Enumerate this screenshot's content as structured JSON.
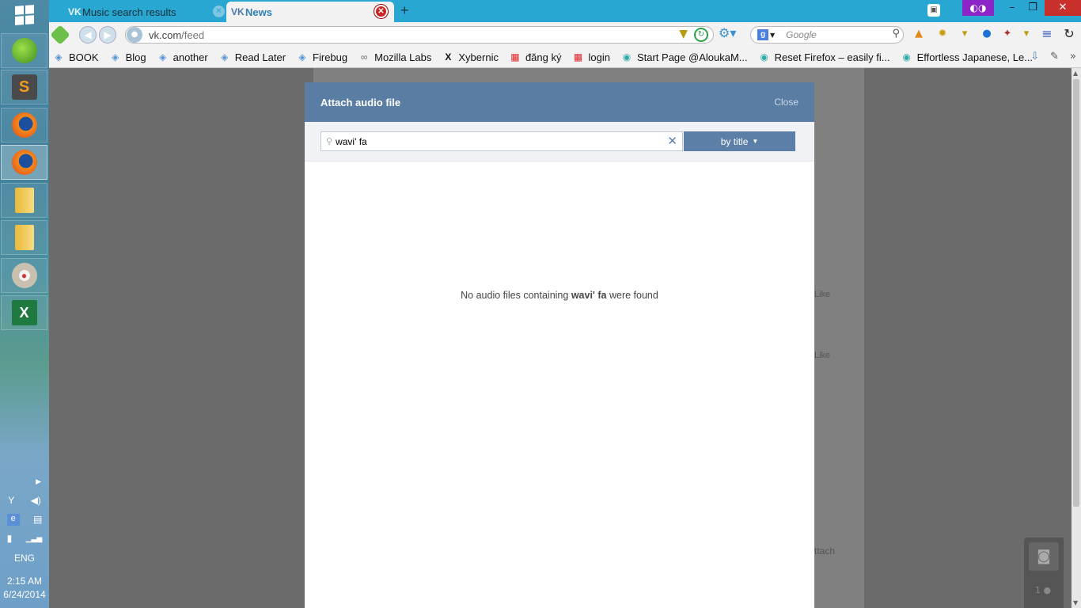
{
  "taskbar": {
    "apps": [
      {
        "name": "parrot-app"
      },
      {
        "name": "sublime-text",
        "letter": "S"
      },
      {
        "name": "firefox"
      },
      {
        "name": "firefox-active"
      },
      {
        "name": "file-explorer"
      },
      {
        "name": "file-explorer-2"
      },
      {
        "name": "paint"
      },
      {
        "name": "excel",
        "letter": "X"
      }
    ],
    "language": "ENG",
    "time": "2:15 AM",
    "date": "6/24/2014"
  },
  "browser": {
    "tabs": [
      {
        "label": "Music search results",
        "active": false
      },
      {
        "label": "News",
        "active": true
      }
    ],
    "url": {
      "host": "vk.com",
      "path": "/feed"
    },
    "search_placeholder": "Google",
    "bookmarks": [
      {
        "label": "BOOK",
        "icon": "shield"
      },
      {
        "label": "Blog",
        "icon": "shield"
      },
      {
        "label": "another",
        "icon": "shield"
      },
      {
        "label": "Read Later",
        "icon": "shield"
      },
      {
        "label": "Firebug",
        "icon": "shield"
      },
      {
        "label": "Mozilla Labs",
        "icon": "labs"
      },
      {
        "label": "Xybernic",
        "icon": "x"
      },
      {
        "label": "đăng ký",
        "icon": "red"
      },
      {
        "label": "login",
        "icon": "red"
      },
      {
        "label": "Start Page @AloukaM...",
        "icon": "globe"
      },
      {
        "label": "Reset Firefox – easily fi...",
        "icon": "globe"
      },
      {
        "label": "Effortless Japanese, Le...",
        "icon": "globe"
      }
    ]
  },
  "page": {
    "like_label": "Like",
    "attach_label": "ttach",
    "photo_count": "1"
  },
  "modal": {
    "title": "Attach audio file",
    "close_label": "Close",
    "search_value": "wavi' fa",
    "filter_label": "by title",
    "empty_prefix": "No audio files containing",
    "empty_query": "wavi' fa",
    "empty_suffix": "were found"
  },
  "colors": {
    "titlebar": "#27a7d1",
    "modal_header": "#597da3",
    "button": "#5b7fa6"
  }
}
